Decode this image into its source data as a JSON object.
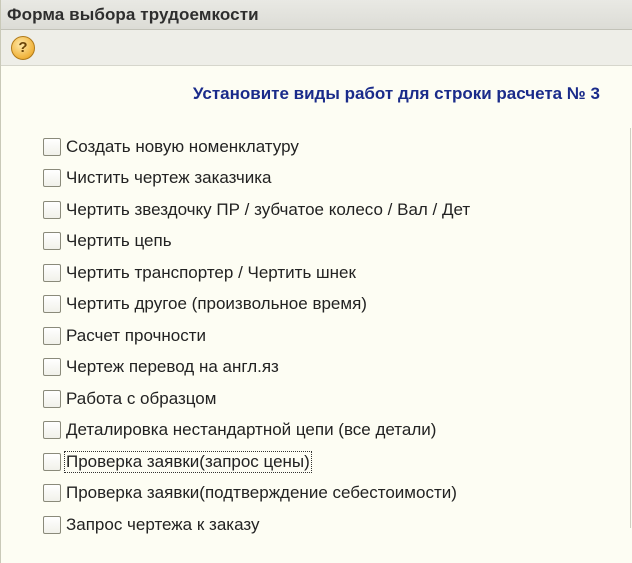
{
  "window": {
    "title": "Форма выбора трудоемкости"
  },
  "toolbar": {
    "help_icon": "help-question-icon",
    "help_glyph": "?"
  },
  "heading": "Установите виды работ для строки расчета № 3",
  "options": [
    {
      "label": "Создать новую номенклатуру",
      "checked": false
    },
    {
      "label": "Чистить чертеж заказчика",
      "checked": false
    },
    {
      "label": "Чертить звездочку ПР / зубчатое колесо / Вал / Дет",
      "checked": false
    },
    {
      "label": "Чертить цепь",
      "checked": false
    },
    {
      "label": "Чертить транспортер / Чертить шнек",
      "checked": false
    },
    {
      "label": "Чертить другое (произвольное время)",
      "checked": false
    },
    {
      "label": "Расчет прочности",
      "checked": false
    },
    {
      "label": "Чертеж перевод на англ.яз",
      "checked": false
    },
    {
      "label": "Работа с образцом",
      "checked": false
    },
    {
      "label": "Деталировка нестандартной цепи (все детали)",
      "checked": false
    },
    {
      "label": "Проверка заявки(запрос цены)",
      "checked": false,
      "focused": true
    },
    {
      "label": "Проверка заявки(подтверждение себестоимости)",
      "checked": false
    },
    {
      "label": "Запрос чертежа к заказу",
      "checked": false
    }
  ],
  "colors": {
    "heading": "#1a2b8a",
    "background": "#fdfdf3"
  }
}
